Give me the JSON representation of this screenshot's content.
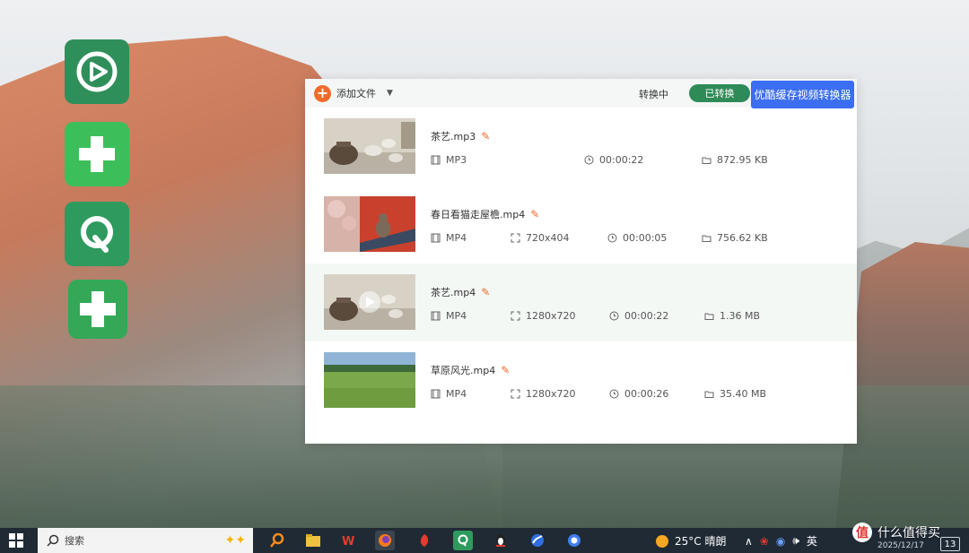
{
  "toolbar": {
    "add_label": "添加文件",
    "tab_converting": "转换中",
    "tab_converted": "已转换",
    "blue_button": "优酷缓存视频转换器"
  },
  "files": [
    {
      "name": "茶艺.mp3",
      "format": "MP3",
      "resolution": "",
      "duration": "00:00:22",
      "size": "872.95 KB"
    },
    {
      "name": "春日看猫走屋檐.mp4",
      "format": "MP4",
      "resolution": "720x404",
      "duration": "00:00:05",
      "size": "756.62 KB"
    },
    {
      "name": "茶艺.mp4",
      "format": "MP4",
      "resolution": "1280x720",
      "duration": "00:00:22",
      "size": "1.36 MB"
    },
    {
      "name": "草原风光.mp4",
      "format": "MP4",
      "resolution": "1280x720",
      "duration": "00:00:26",
      "size": "35.40 MB"
    }
  ],
  "taskbar": {
    "search_label": "搜索",
    "weather": "25°C 晴朗",
    "ime": "英",
    "date": "2025/12/17",
    "notification_count": "13"
  },
  "watermark": {
    "logo": "值",
    "text": "什么值得买"
  },
  "colors": {
    "accent_orange": "#f26a2a",
    "accent_green": "#2e8b57",
    "accent_blue": "#3b6ef0"
  }
}
